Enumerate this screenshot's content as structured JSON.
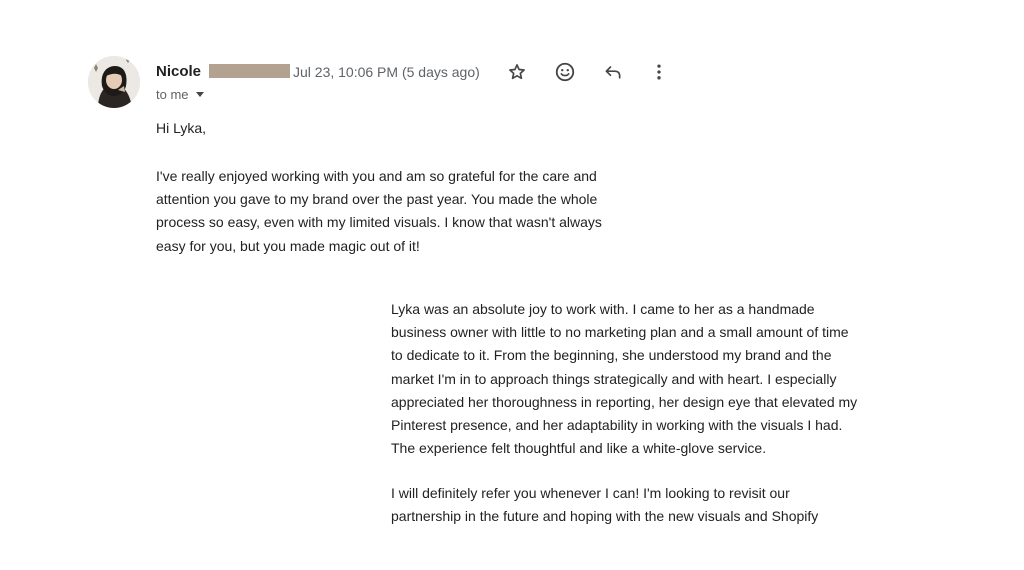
{
  "email": {
    "sender_first_name": "Nicole",
    "date": "Jul 23, 10:06 PM (5 days ago)",
    "to_label": "to me"
  },
  "actions": {
    "star_icon": "star-outline-icon",
    "emoji_icon": "emoji-reaction-icon",
    "reply_icon": "reply-icon",
    "more_icon": "more-vertical-icon"
  },
  "body": {
    "greeting": "Hi Lyka,",
    "paragraph_lines": [
      "I've really enjoyed working with you and am so grateful for the care and",
      "attention you gave to my brand over the past year. You made the whole",
      "process so easy, even with my limited visuals. I know that wasn't always",
      "easy for you, but you made magic out of it!"
    ],
    "quote_lines": [
      "Lyka was an absolute joy to work with. I came to her as a handmade",
      "business owner with little to no marketing plan and a small amount of time",
      "to dedicate to it. From the beginning, she understood my brand and the",
      "market I'm in to approach things strategically and with heart. I especially",
      "appreciated her thoroughness in reporting, her design eye that elevated my",
      "Pinterest presence, and her adaptability in working with the visuals I had.",
      "The experience felt thoughtful and like a white-glove service."
    ],
    "closing_lines": [
      "I will definitely refer you whenever I can! I'm looking to revisit our",
      "partnership in the future and hoping with the new visuals and Shopify"
    ]
  },
  "colors": {
    "redaction": "#b2a28f",
    "secondary_text": "#5f6368",
    "primary_text": "#202124"
  }
}
